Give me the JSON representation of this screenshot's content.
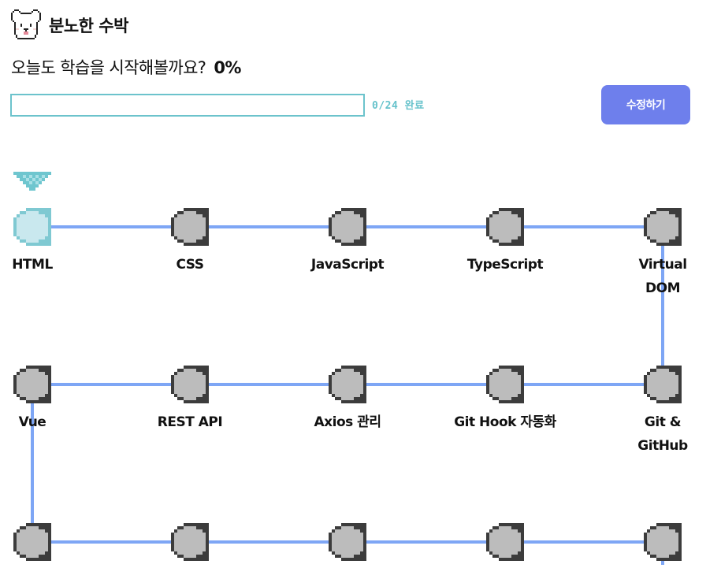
{
  "header": {
    "username": "분노한 수박",
    "avatar_icon": "pixel-dog-face-icon"
  },
  "progress": {
    "headline": "오늘도 학습을 시작해볼까요?",
    "percent_label": "0%",
    "fraction": 0,
    "status_text": "0/24 완료",
    "bar_color": "#6cc3cc"
  },
  "edit_button": {
    "label": "수정하기",
    "color": "#6e7fec"
  },
  "roadmap": {
    "path_color": "#7ea6f5",
    "current_node_color": "#c9e8ee",
    "current_marker_icon": "pixel-triangle-down-icon",
    "node_color": "#bcbcbc",
    "nodes": [
      {
        "label": "HTML",
        "current": true
      },
      {
        "label": "CSS"
      },
      {
        "label": "JavaScript"
      },
      {
        "label": "TypeScript"
      },
      {
        "label": "Virtual DOM"
      },
      {
        "label": "Git & GitHub"
      },
      {
        "label": "Git Hook 자동화"
      },
      {
        "label": "Axios 관리"
      },
      {
        "label": "REST API"
      },
      {
        "label": "Vue"
      },
      {
        "label": ""
      },
      {
        "label": ""
      },
      {
        "label": ""
      },
      {
        "label": ""
      },
      {
        "label": ""
      }
    ]
  }
}
